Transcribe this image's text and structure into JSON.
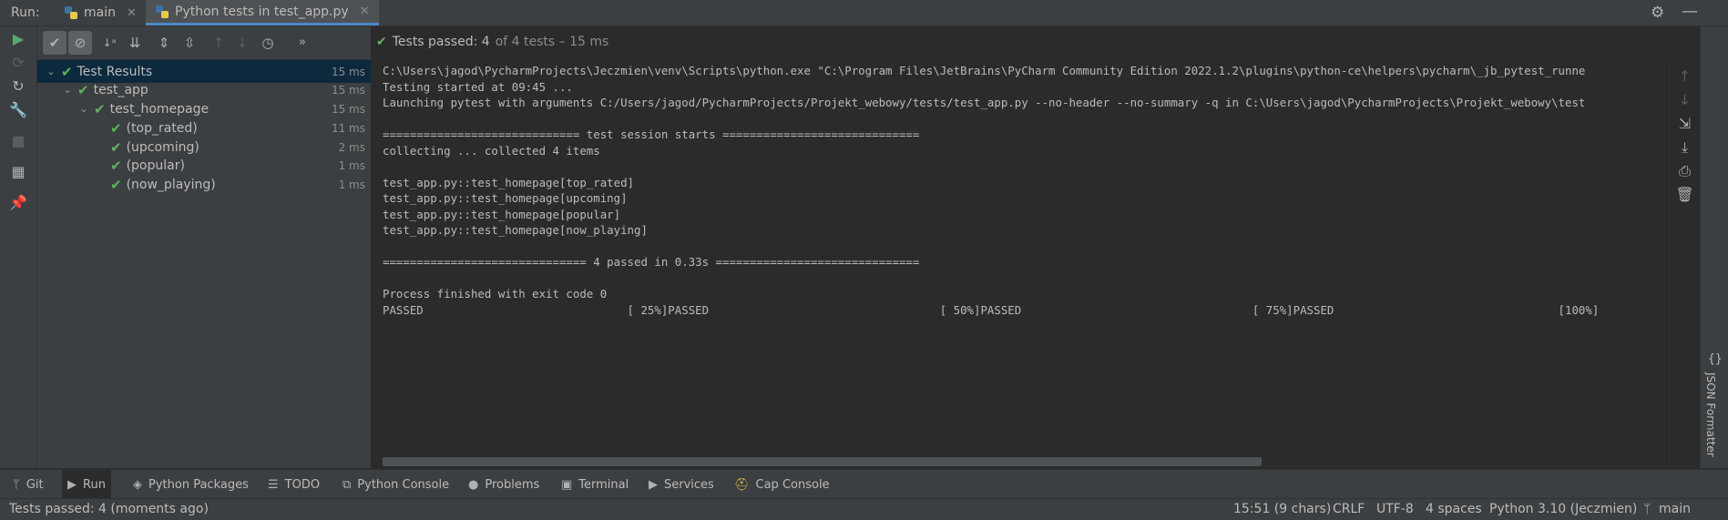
{
  "topbar": {
    "run_label": "Run:",
    "tabs": [
      {
        "label": "main"
      },
      {
        "label": "Python tests in test_app.py"
      }
    ]
  },
  "test_status": {
    "passed_label": "Tests passed: 4",
    "detail": "of 4 tests – 15 ms"
  },
  "tree": [
    {
      "label": "Test Results",
      "time": "15 ms"
    },
    {
      "label": "test_app",
      "time": "15 ms"
    },
    {
      "label": "test_homepage",
      "time": "15 ms"
    },
    {
      "label": "(top_rated)",
      "time": "11 ms"
    },
    {
      "label": "(upcoming)",
      "time": "2 ms"
    },
    {
      "label": "(popular)",
      "time": "1 ms"
    },
    {
      "label": "(now_playing)",
      "time": "1 ms"
    }
  ],
  "console": {
    "lines": [
      "C:\\Users\\jagod\\PycharmProjects\\Jeczmien\\venv\\Scripts\\python.exe \"C:\\Program Files\\JetBrains\\PyCharm Community Edition 2022.1.2\\plugins\\python-ce\\helpers\\pycharm\\_jb_pytest_runne",
      "Testing started at 09:45 ...",
      "Launching pytest with arguments C:/Users/jagod/PycharmProjects/Projekt_webowy/tests/test_app.py --no-header --no-summary -q in C:\\Users\\jagod\\PycharmProjects\\Projekt_webowy\\test",
      "",
      "============================= test session starts =============================",
      "collecting ... collected 4 items",
      "",
      "test_app.py::test_homepage[top_rated]",
      "test_app.py::test_homepage[upcoming]",
      "test_app.py::test_homepage[popular]",
      "test_app.py::test_homepage[now_playing]",
      "",
      "============================== 4 passed in 0.33s ==============================",
      "",
      "Process finished with exit code 0",
      "PASSED                              [ 25%]PASSED                                  [ 50%]PASSED                                  [ 75%]PASSED                                 [100%]"
    ]
  },
  "bottom_tabs": [
    {
      "label": "Git",
      "icon": "git-branch-icon"
    },
    {
      "label": "Run",
      "icon": "run-icon"
    },
    {
      "label": "Python Packages",
      "icon": "packages-icon"
    },
    {
      "label": "TODO",
      "icon": "todo-icon"
    },
    {
      "label": "Python Console",
      "icon": "python-console-icon"
    },
    {
      "label": "Problems",
      "icon": "problems-icon"
    },
    {
      "label": "Terminal",
      "icon": "terminal-icon"
    },
    {
      "label": "Services",
      "icon": "services-icon"
    },
    {
      "label": "Cap Console",
      "icon": "cap-console-icon"
    }
  ],
  "right_panel": {
    "json_formatter": "JSON Formatter"
  },
  "statusbar": {
    "message": "Tests passed: 4 (moments ago)",
    "position": "15:51 (9 chars)",
    "line_sep": "CRLF",
    "encoding": "UTF-8",
    "indent": "4 spaces",
    "interpreter": "Python 3.10 (Jeczmien)",
    "branch": "main"
  },
  "colors": {
    "pass": "#5fb35f",
    "accent": "#4a88c7",
    "selection": "#0d293e"
  }
}
